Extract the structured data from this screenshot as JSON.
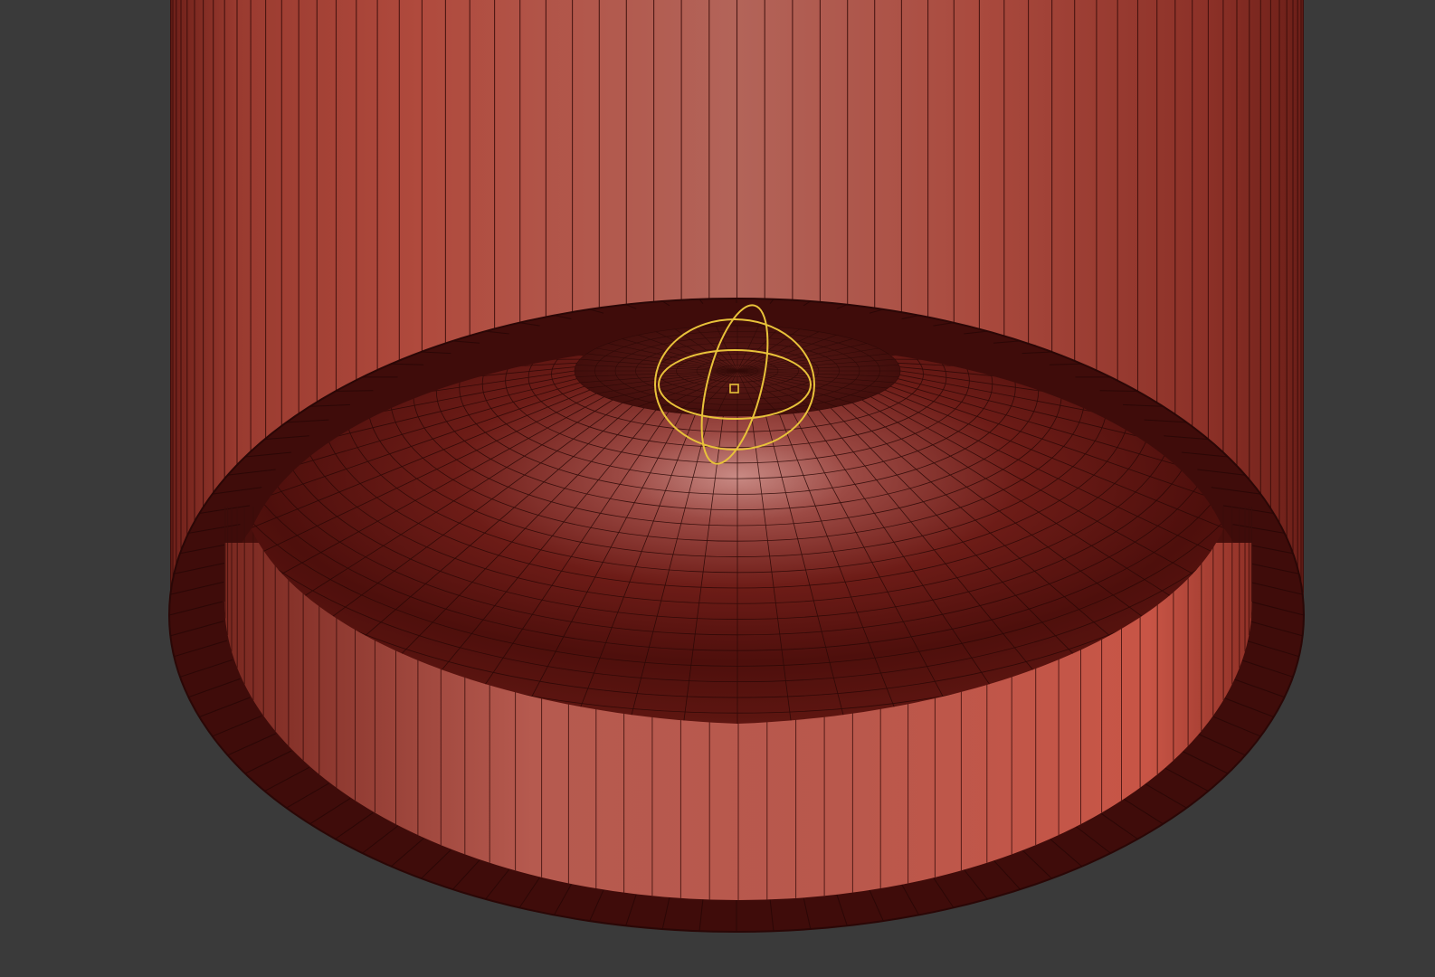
{
  "viewport": {
    "background_color": "#3a3a3a"
  },
  "mesh": {
    "object": "cylinder-with-inner-dome",
    "base_color": "#a5473c",
    "shadow_color": "#3b0a08",
    "wire_color": "#2a0806",
    "highlight_color": "#c07a72"
  },
  "gizmo": {
    "icon": "transpose-rotate-gizmo-icon",
    "color": "#e8c23a"
  }
}
